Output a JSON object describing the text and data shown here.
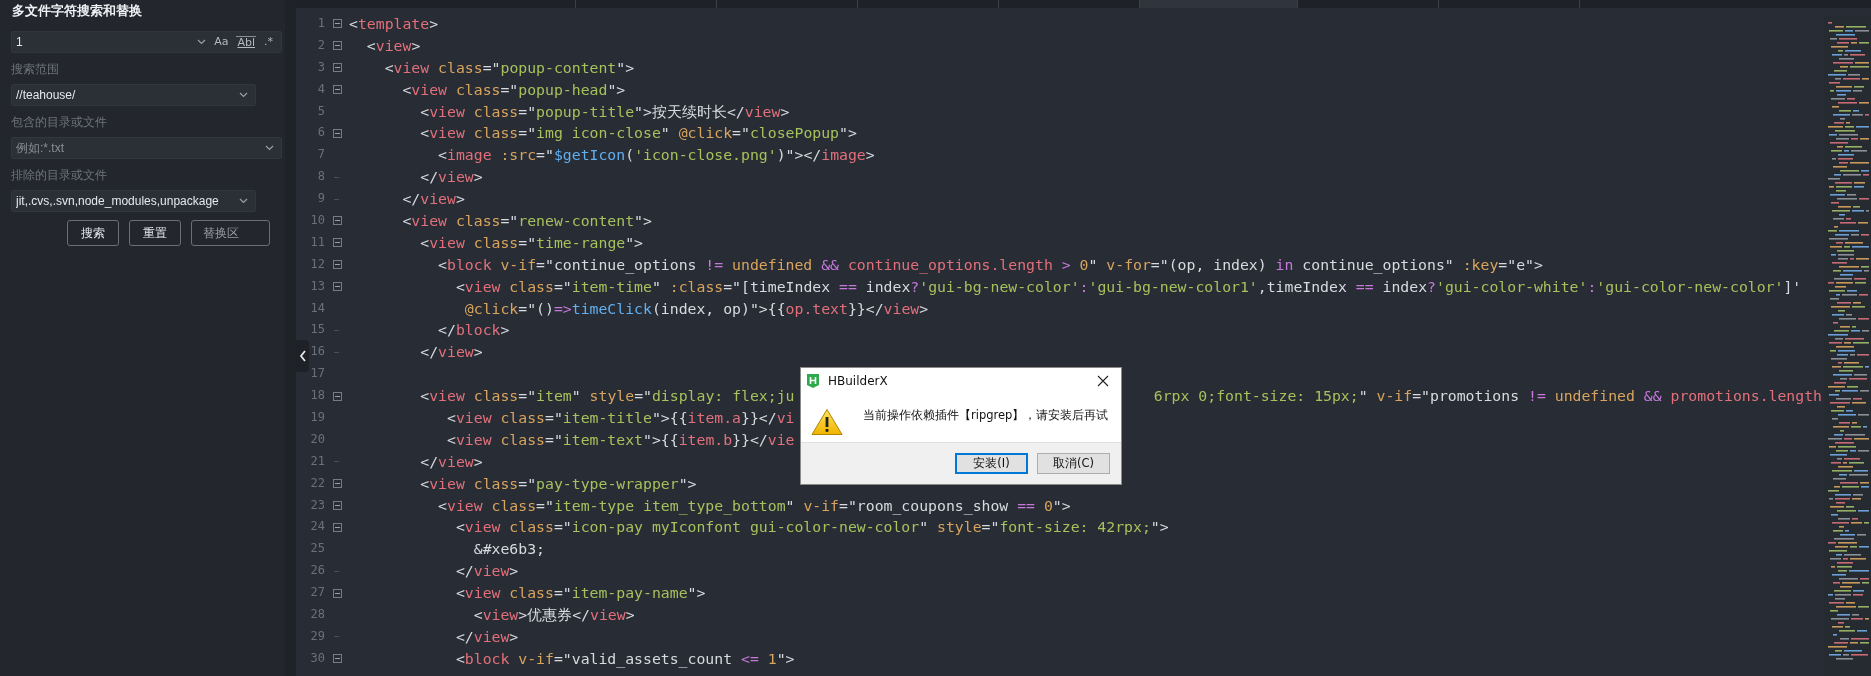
{
  "search_panel": {
    "title": "多文件字符搜索和替换",
    "search_field": {
      "value": "1"
    },
    "option_buttons": [
      {
        "label": "Aa",
        "kind": "case"
      },
      {
        "label": "Abl",
        "kind": "word"
      },
      {
        "label": ".*",
        "kind": "regex"
      }
    ],
    "scope_label": "搜索范围",
    "scope_field": {
      "value": "//teahouse/"
    },
    "include_label": "包含的目录或文件",
    "include_field": {
      "placeholder": "例如:*.txt"
    },
    "exclude_label": "排除的目录或文件",
    "exclude_field": {
      "value": "jit,.cvs,.svn,node_modules,unpackage"
    },
    "buttons": [
      {
        "label": "搜索",
        "kind": "action"
      },
      {
        "label": "重置",
        "kind": "action"
      },
      {
        "label": "替换区",
        "kind": "toggle"
      }
    ]
  },
  "editor": {
    "tabs": [
      {
        "selected": false
      },
      {
        "selected": false
      },
      {
        "selected": false
      },
      {
        "selected": false
      },
      {
        "selected": false
      },
      {
        "selected": true
      },
      {
        "selected": false
      },
      {
        "selected": false
      }
    ],
    "lines": [
      {
        "number": "1",
        "foldable": true,
        "tokens": [
          {
            "kind": "p",
            "text": "<"
          },
          {
            "kind": "tag",
            "text": "template"
          },
          {
            "kind": "p",
            "text": ">"
          }
        ]
      },
      {
        "number": "2",
        "foldable": true,
        "tokens": [
          {
            "kind": "p",
            "text": "  <"
          },
          {
            "kind": "tag",
            "text": "view"
          },
          {
            "kind": "p",
            "text": ">"
          }
        ]
      },
      {
        "number": "3",
        "foldable": true,
        "tokens": [
          {
            "kind": "p",
            "text": "    <"
          },
          {
            "kind": "tag",
            "text": "view "
          },
          {
            "kind": "attr",
            "text": "class"
          },
          {
            "kind": "p",
            "text": "=\""
          },
          {
            "kind": "str",
            "text": "popup-content"
          },
          {
            "kind": "p",
            "text": "\">"
          }
        ]
      },
      {
        "number": "4",
        "foldable": true,
        "tokens": [
          {
            "kind": "p",
            "text": "      <"
          },
          {
            "kind": "tag",
            "text": "view "
          },
          {
            "kind": "attr",
            "text": "class"
          },
          {
            "kind": "p",
            "text": "=\""
          },
          {
            "kind": "str",
            "text": "popup-head"
          },
          {
            "kind": "p",
            "text": "\">"
          }
        ]
      },
      {
        "number": "5",
        "tokens": [
          {
            "kind": "p",
            "text": "        <"
          },
          {
            "kind": "tag",
            "text": "view "
          },
          {
            "kind": "attr",
            "text": "class"
          },
          {
            "kind": "p",
            "text": "=\""
          },
          {
            "kind": "str",
            "text": "popup-title"
          },
          {
            "kind": "p",
            "text": "\">按天续时长</"
          },
          {
            "kind": "tag",
            "text": "view"
          },
          {
            "kind": "p",
            "text": ">"
          }
        ]
      },
      {
        "number": "6",
        "foldable": true,
        "tokens": [
          {
            "kind": "p",
            "text": "        <"
          },
          {
            "kind": "tag",
            "text": "view "
          },
          {
            "kind": "attr",
            "text": "class"
          },
          {
            "kind": "p",
            "text": "=\""
          },
          {
            "kind": "str",
            "text": "img icon-close"
          },
          {
            "kind": "p",
            "text": "\" "
          },
          {
            "kind": "attr",
            "text": "@click"
          },
          {
            "kind": "p",
            "text": "=\""
          },
          {
            "kind": "str",
            "text": "closePopup"
          },
          {
            "kind": "p",
            "text": "\">"
          }
        ]
      },
      {
        "number": "7",
        "tokens": [
          {
            "kind": "p",
            "text": "          <"
          },
          {
            "kind": "tag",
            "text": "image "
          },
          {
            "kind": "attr",
            "text": ":src"
          },
          {
            "kind": "p",
            "text": "=\""
          },
          {
            "kind": "fn",
            "text": "$getIcon"
          },
          {
            "kind": "p",
            "text": "("
          },
          {
            "kind": "str",
            "text": "'icon-close.png'"
          },
          {
            "kind": "p",
            "text": ")\"></"
          },
          {
            "kind": "tag",
            "text": "image"
          },
          {
            "kind": "p",
            "text": ">"
          }
        ]
      },
      {
        "number": "8",
        "fold_end": true,
        "tokens": [
          {
            "kind": "p",
            "text": "        </"
          },
          {
            "kind": "tag",
            "text": "view"
          },
          {
            "kind": "p",
            "text": ">"
          }
        ]
      },
      {
        "number": "9",
        "fold_end": true,
        "tokens": [
          {
            "kind": "p",
            "text": "      </"
          },
          {
            "kind": "tag",
            "text": "view"
          },
          {
            "kind": "p",
            "text": ">"
          }
        ]
      },
      {
        "number": "10",
        "foldable": true,
        "tokens": [
          {
            "kind": "p",
            "text": "      <"
          },
          {
            "kind": "tag",
            "text": "view "
          },
          {
            "kind": "attr",
            "text": "class"
          },
          {
            "kind": "p",
            "text": "=\""
          },
          {
            "kind": "str",
            "text": "renew-content"
          },
          {
            "kind": "p",
            "text": "\">"
          }
        ]
      },
      {
        "number": "11",
        "foldable": true,
        "tokens": [
          {
            "kind": "p",
            "text": "        <"
          },
          {
            "kind": "tag",
            "text": "view "
          },
          {
            "kind": "attr",
            "text": "class"
          },
          {
            "kind": "p",
            "text": "=\""
          },
          {
            "kind": "str",
            "text": "time-range"
          },
          {
            "kind": "p",
            "text": "\">"
          }
        ]
      },
      {
        "number": "12",
        "foldable": true,
        "tokens": [
          {
            "kind": "p",
            "text": "          <"
          },
          {
            "kind": "tag",
            "text": "block "
          },
          {
            "kind": "attr",
            "text": "v-if"
          },
          {
            "kind": "p",
            "text": "=\"continue_options "
          },
          {
            "kind": "kw",
            "text": "!= "
          },
          {
            "kind": "attr",
            "text": "undefined "
          },
          {
            "kind": "kw",
            "text": "&& "
          },
          {
            "kind": "tag",
            "text": "continue_options.length "
          },
          {
            "kind": "kw",
            "text": "> "
          },
          {
            "kind": "attr",
            "text": "0"
          },
          {
            "kind": "p",
            "text": "\" "
          },
          {
            "kind": "attr",
            "text": "v-for"
          },
          {
            "kind": "p",
            "text": "=\"(op, index) "
          },
          {
            "kind": "kw",
            "text": "in"
          },
          {
            "kind": "p",
            "text": " continue_options\" "
          },
          {
            "kind": "attr",
            "text": ":key"
          },
          {
            "kind": "p",
            "text": "=\"e\">"
          }
        ]
      },
      {
        "number": "13",
        "foldable": true,
        "tokens": [
          {
            "kind": "p",
            "text": "            <"
          },
          {
            "kind": "tag",
            "text": "view "
          },
          {
            "kind": "attr",
            "text": "class"
          },
          {
            "kind": "p",
            "text": "=\""
          },
          {
            "kind": "str",
            "text": "item-time"
          },
          {
            "kind": "p",
            "text": "\" "
          },
          {
            "kind": "attr",
            "text": ":class"
          },
          {
            "kind": "p",
            "text": "=\"[timeIndex "
          },
          {
            "kind": "kw",
            "text": "=="
          },
          {
            "kind": "p",
            "text": " index"
          },
          {
            "kind": "kw",
            "text": "?"
          },
          {
            "kind": "str",
            "text": "'gui-bg-new-color'"
          },
          {
            "kind": "kw",
            "text": ":"
          },
          {
            "kind": "str",
            "text": "'gui-bg-new-color1'"
          },
          {
            "kind": "p",
            "text": ",timeIndex "
          },
          {
            "kind": "kw",
            "text": "=="
          },
          {
            "kind": "p",
            "text": " index"
          },
          {
            "kind": "kw",
            "text": "?"
          },
          {
            "kind": "str",
            "text": "'gui-color-white'"
          },
          {
            "kind": "kw",
            "text": ":"
          },
          {
            "kind": "str",
            "text": "'gui-color-new-color'"
          },
          {
            "kind": "p",
            "text": "]'"
          }
        ]
      },
      {
        "number": "14",
        "tokens": [
          {
            "kind": "attr",
            "text": "             @click"
          },
          {
            "kind": "p",
            "text": "=\"()"
          },
          {
            "kind": "kw",
            "text": "=>"
          },
          {
            "kind": "fn",
            "text": "timeClick"
          },
          {
            "kind": "p",
            "text": "(index, op)\">{{"
          },
          {
            "kind": "tag",
            "text": "op.text"
          },
          {
            "kind": "p",
            "text": "}}</"
          },
          {
            "kind": "tag",
            "text": "view"
          },
          {
            "kind": "p",
            "text": ">"
          }
        ]
      },
      {
        "number": "15",
        "fold_end": true,
        "tokens": [
          {
            "kind": "p",
            "text": "          </"
          },
          {
            "kind": "tag",
            "text": "block"
          },
          {
            "kind": "p",
            "text": ">"
          }
        ]
      },
      {
        "number": "16",
        "fold_end": true,
        "tokens": [
          {
            "kind": "p",
            "text": "        </"
          },
          {
            "kind": "tag",
            "text": "view"
          },
          {
            "kind": "p",
            "text": ">"
          }
        ]
      },
      {
        "number": "17"
      },
      {
        "number": "18",
        "foldable": true,
        "tokens": [
          {
            "kind": "p",
            "text": "        <"
          },
          {
            "kind": "tag",
            "text": "view "
          },
          {
            "kind": "attr",
            "text": "class"
          },
          {
            "kind": "p",
            "text": "=\""
          },
          {
            "kind": "str",
            "text": "item"
          },
          {
            "kind": "p",
            "text": "\" "
          },
          {
            "kind": "attr",
            "text": "style"
          },
          {
            "kind": "p",
            "text": "=\""
          },
          {
            "kind": "str",
            "text": "display: flex;ju"
          }
        ],
        "tail": [
          {
            "kind": "str",
            "text": "6rpx 0;font-size: 15px;"
          },
          {
            "kind": "p",
            "text": "\" "
          },
          {
            "kind": "attr",
            "text": "v-if"
          },
          {
            "kind": "p",
            "text": "=\"promotions "
          },
          {
            "kind": "kw",
            "text": "!= "
          },
          {
            "kind": "attr",
            "text": "undefined "
          },
          {
            "kind": "kw",
            "text": "&& "
          },
          {
            "kind": "tag",
            "text": "promotions.length"
          }
        ]
      },
      {
        "number": "19",
        "tokens": [
          {
            "kind": "p",
            "text": "           <"
          },
          {
            "kind": "tag",
            "text": "view "
          },
          {
            "kind": "attr",
            "text": "class"
          },
          {
            "kind": "p",
            "text": "=\""
          },
          {
            "kind": "str",
            "text": "item-title"
          },
          {
            "kind": "p",
            "text": "\">{{"
          },
          {
            "kind": "tag",
            "text": "item.a"
          },
          {
            "kind": "p",
            "text": "}}</"
          },
          {
            "kind": "tag",
            "text": "vi"
          }
        ]
      },
      {
        "number": "20",
        "tokens": [
          {
            "kind": "p",
            "text": "           <"
          },
          {
            "kind": "tag",
            "text": "view "
          },
          {
            "kind": "attr",
            "text": "class"
          },
          {
            "kind": "p",
            "text": "=\""
          },
          {
            "kind": "str",
            "text": "item-text"
          },
          {
            "kind": "p",
            "text": "\">{{"
          },
          {
            "kind": "tag",
            "text": "item.b"
          },
          {
            "kind": "p",
            "text": "}}</"
          },
          {
            "kind": "tag",
            "text": "vie"
          }
        ]
      },
      {
        "number": "21",
        "fold_end": true,
        "tokens": [
          {
            "kind": "p",
            "text": "        </"
          },
          {
            "kind": "tag",
            "text": "view"
          },
          {
            "kind": "p",
            "text": ">"
          }
        ]
      },
      {
        "number": "22",
        "foldable": true,
        "tokens": [
          {
            "kind": "p",
            "text": "        <"
          },
          {
            "kind": "tag",
            "text": "view "
          },
          {
            "kind": "attr",
            "text": "class"
          },
          {
            "kind": "p",
            "text": "=\""
          },
          {
            "kind": "str",
            "text": "pay-type-wrapper"
          },
          {
            "kind": "p",
            "text": "\">"
          }
        ]
      },
      {
        "number": "23",
        "foldable": true,
        "tokens": [
          {
            "kind": "p",
            "text": "          <"
          },
          {
            "kind": "tag",
            "text": "view "
          },
          {
            "kind": "attr",
            "text": "class"
          },
          {
            "kind": "p",
            "text": "=\""
          },
          {
            "kind": "str",
            "text": "item-type item_type_bottom"
          },
          {
            "kind": "p",
            "text": "\" "
          },
          {
            "kind": "attr",
            "text": "v-if"
          },
          {
            "kind": "p",
            "text": "=\"room_coupons_show "
          },
          {
            "kind": "kw",
            "text": "== "
          },
          {
            "kind": "attr",
            "text": "0"
          },
          {
            "kind": "p",
            "text": "\">"
          }
        ]
      },
      {
        "number": "24",
        "foldable": true,
        "tokens": [
          {
            "kind": "p",
            "text": "            <"
          },
          {
            "kind": "tag",
            "text": "view "
          },
          {
            "kind": "attr",
            "text": "class"
          },
          {
            "kind": "p",
            "text": "=\""
          },
          {
            "kind": "str",
            "text": "icon-pay myIconfont gui-color-new-color"
          },
          {
            "kind": "p",
            "text": "\" "
          },
          {
            "kind": "attr",
            "text": "style"
          },
          {
            "kind": "p",
            "text": "=\""
          },
          {
            "kind": "str",
            "text": "font-size: 42rpx;"
          },
          {
            "kind": "p",
            "text": "\">"
          }
        ]
      },
      {
        "number": "25",
        "tokens": [
          {
            "kind": "p",
            "text": "              &#xe6b3;"
          }
        ]
      },
      {
        "number": "26",
        "fold_end": true,
        "tokens": [
          {
            "kind": "p",
            "text": "            </"
          },
          {
            "kind": "tag",
            "text": "view"
          },
          {
            "kind": "p",
            "text": ">"
          }
        ]
      },
      {
        "number": "27",
        "foldable": true,
        "tokens": [
          {
            "kind": "p",
            "text": "            <"
          },
          {
            "kind": "tag",
            "text": "view "
          },
          {
            "kind": "attr",
            "text": "class"
          },
          {
            "kind": "p",
            "text": "=\""
          },
          {
            "kind": "str",
            "text": "item-pay-name"
          },
          {
            "kind": "p",
            "text": "\">"
          }
        ]
      },
      {
        "number": "28",
        "tokens": [
          {
            "kind": "p",
            "text": "              <"
          },
          {
            "kind": "tag",
            "text": "view"
          },
          {
            "kind": "p",
            "text": ">优惠券</"
          },
          {
            "kind": "tag",
            "text": "view"
          },
          {
            "kind": "p",
            "text": ">"
          }
        ]
      },
      {
        "number": "29",
        "fold_end": true,
        "tokens": [
          {
            "kind": "p",
            "text": "            </"
          },
          {
            "kind": "tag",
            "text": "view"
          },
          {
            "kind": "p",
            "text": ">"
          }
        ]
      },
      {
        "number": "30",
        "foldable": true,
        "tokens": [
          {
            "kind": "p",
            "text": "            <"
          },
          {
            "kind": "tag",
            "text": "block "
          },
          {
            "kind": "attr",
            "text": "v-if"
          },
          {
            "kind": "p",
            "text": "=\"valid_assets_count "
          },
          {
            "kind": "kw",
            "text": "<= "
          },
          {
            "kind": "attr",
            "text": "1"
          },
          {
            "kind": "p",
            "text": "\">"
          }
        ]
      }
    ]
  },
  "dialog": {
    "title": "HBuilderX",
    "message": "当前操作依赖插件【ripgrep】，请安装后再试",
    "buttons": [
      {
        "label": "安装(I)",
        "default": true
      },
      {
        "label": "取消(C)",
        "default": false
      }
    ]
  }
}
